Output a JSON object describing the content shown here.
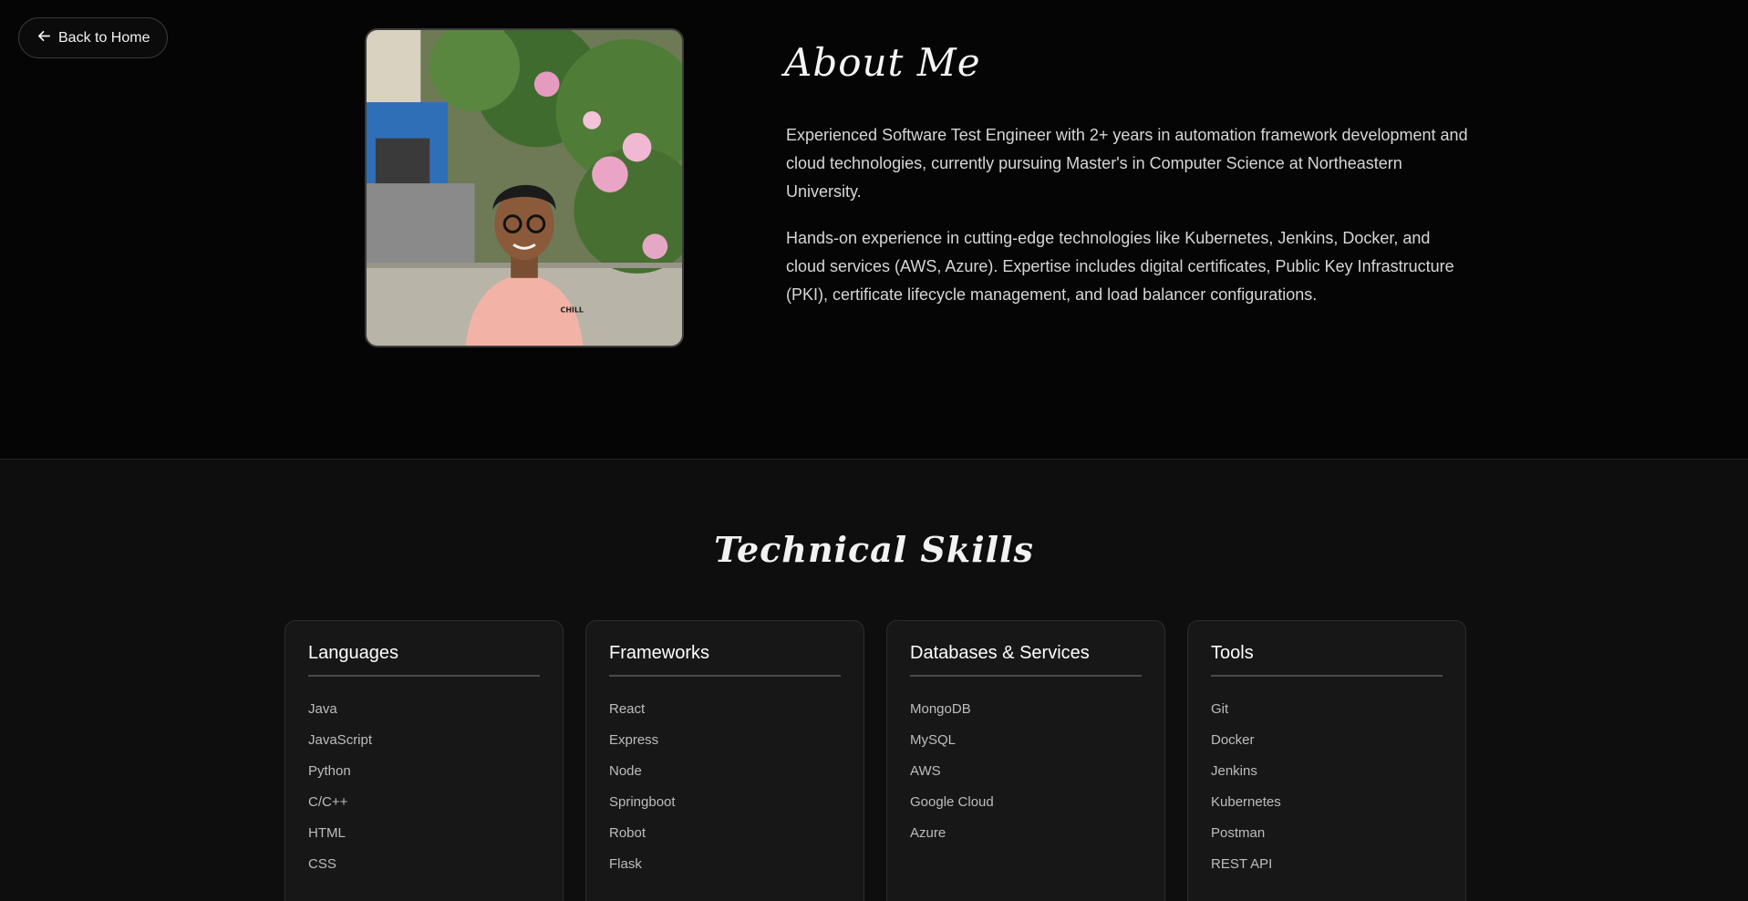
{
  "nav": {
    "back_label": "Back to Home"
  },
  "about": {
    "title": "About Me",
    "paragraph1": "Experienced Software Test Engineer with 2+ years in automation framework development and cloud technologies, currently pursuing Master's in Computer Science at Northeastern University.",
    "paragraph2": "Hands-on experience in cutting-edge technologies like Kubernetes, Jenkins, Docker, and cloud services (AWS, Azure). Expertise includes digital certificates, Public Key Infrastructure (PKI), certificate lifecycle management, and load balancer configurations.",
    "photo_shirt_text": "CHILL"
  },
  "skills": {
    "title": "Technical Skills",
    "categories": [
      {
        "name": "Languages",
        "items": [
          "Java",
          "JavaScript",
          "Python",
          "C/C++",
          "HTML",
          "CSS"
        ]
      },
      {
        "name": "Frameworks",
        "items": [
          "React",
          "Express",
          "Node",
          "Springboot",
          "Robot",
          "Flask"
        ]
      },
      {
        "name": "Databases & Services",
        "items": [
          "MongoDB",
          "MySQL",
          "AWS",
          "Google Cloud",
          "Azure"
        ]
      },
      {
        "name": "Tools",
        "items": [
          "Git",
          "Docker",
          "Jenkins",
          "Kubernetes",
          "Postman",
          "REST API"
        ]
      }
    ]
  }
}
